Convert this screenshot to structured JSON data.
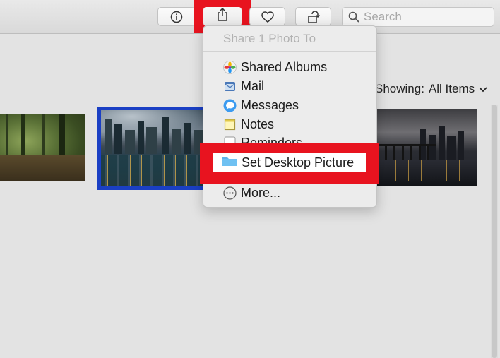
{
  "toolbar": {
    "info_icon": "info-icon",
    "share_icon": "share-icon",
    "favorite_icon": "heart-icon",
    "rotate_icon": "rotate-icon",
    "search": {
      "placeholder": "Search",
      "value": ""
    }
  },
  "filter": {
    "label": "Showing:",
    "value": "All Items"
  },
  "share_menu": {
    "header": "Share 1 Photo To",
    "items": [
      {
        "label": "Shared Albums",
        "icon": "shared-albums-icon"
      },
      {
        "label": "Mail",
        "icon": "mail-icon"
      },
      {
        "label": "Messages",
        "icon": "messages-icon"
      },
      {
        "label": "Notes",
        "icon": "notes-icon"
      },
      {
        "label": "Reminders",
        "icon": "reminders-icon"
      },
      {
        "label": "Set Desktop Picture",
        "icon": "folder-icon"
      },
      {
        "label": "More...",
        "icon": "more-icon"
      }
    ]
  },
  "colors": {
    "highlight": "#e8131f",
    "selection": "#1a3fc4"
  }
}
